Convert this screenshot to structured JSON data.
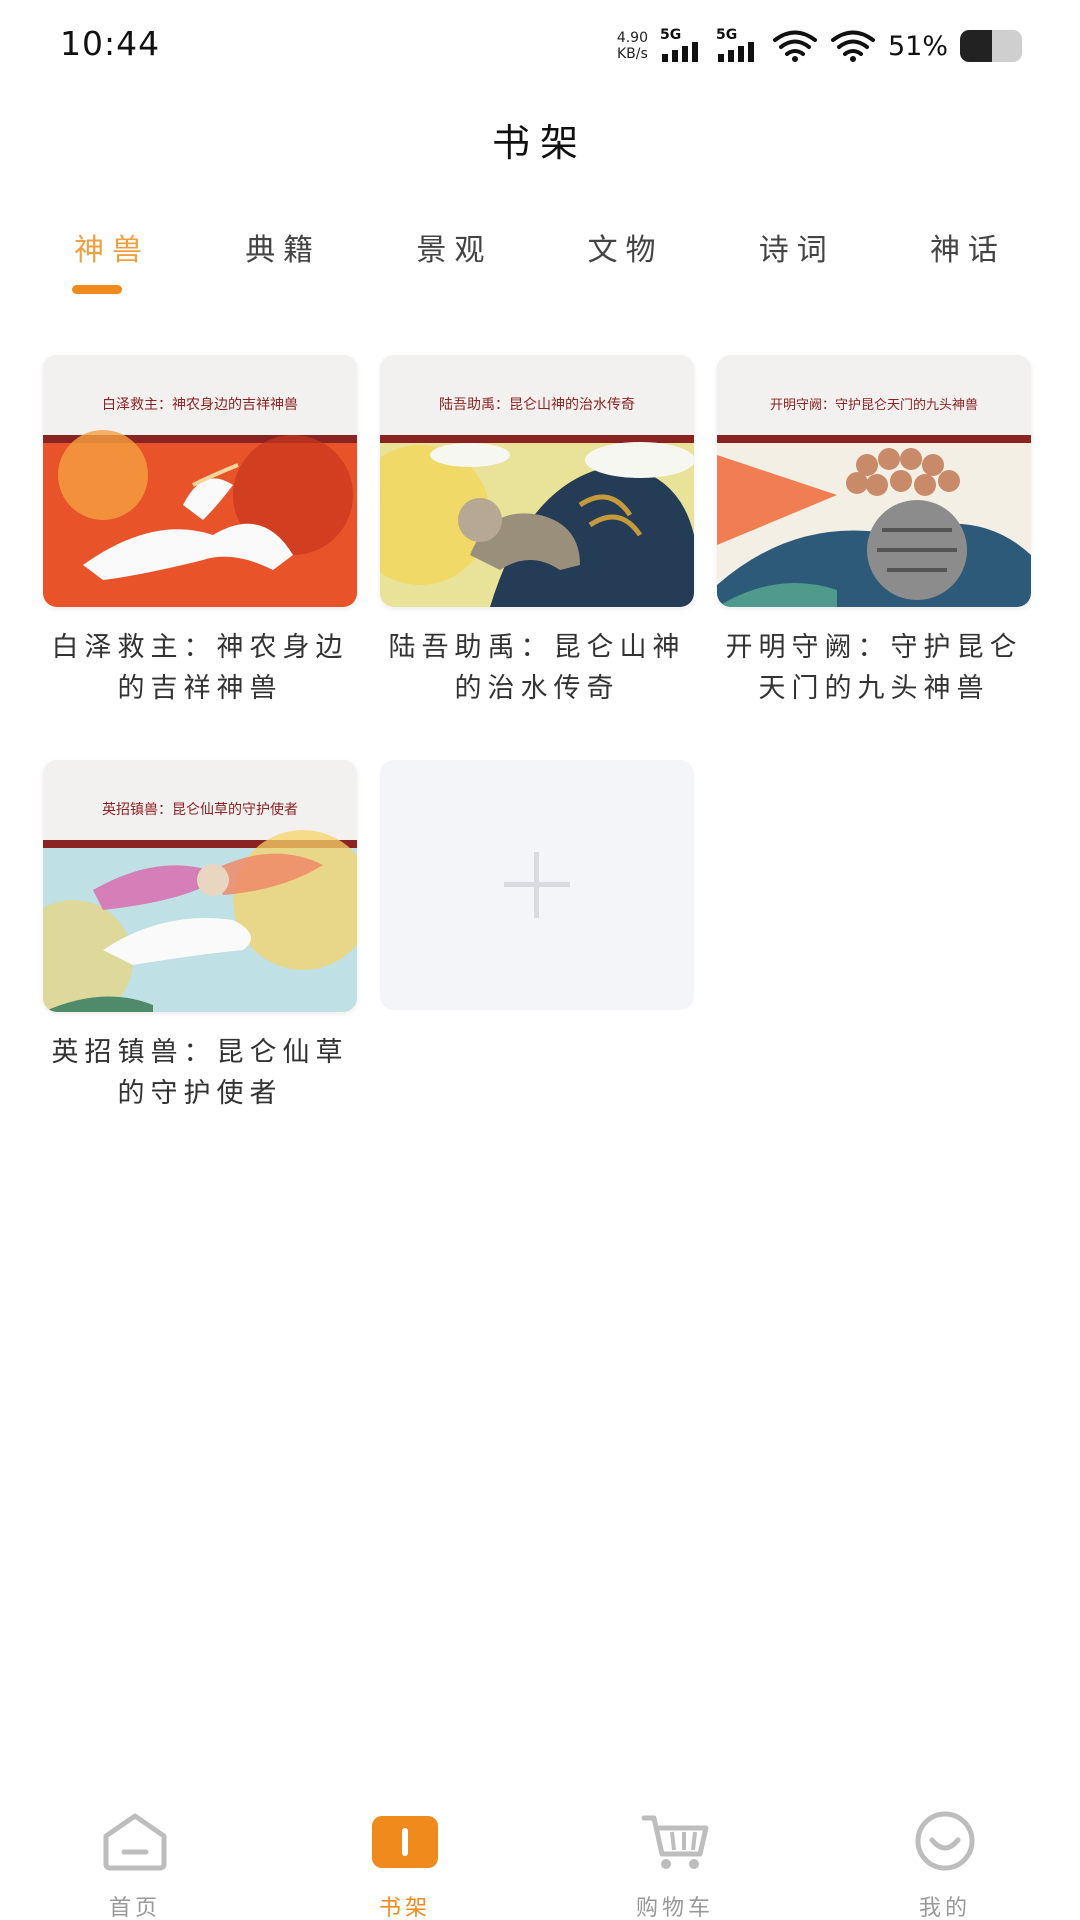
{
  "status_bar": {
    "time": "10:44",
    "net_speed_value": "4.90",
    "net_speed_unit": "KB/s",
    "signal_1": "5G",
    "signal_2": "5G",
    "battery_percent": "51%",
    "battery_level": 0.51
  },
  "page": {
    "title": "书架"
  },
  "tabs": [
    {
      "label": "神兽",
      "active": true
    },
    {
      "label": "典籍",
      "active": false
    },
    {
      "label": "景观",
      "active": false
    },
    {
      "label": "文物",
      "active": false
    },
    {
      "label": "诗词",
      "active": false
    },
    {
      "label": "神话",
      "active": false
    }
  ],
  "books": [
    {
      "title": "白泽救主：神农身边的吉祥神兽",
      "cover_heading": "白泽救主：神农身边的吉祥神兽"
    },
    {
      "title": "陆吾助禹：昆仑山神的治水传奇",
      "cover_heading": "陆吾助禹：昆仑山神的治水传奇"
    },
    {
      "title": "开明守阙：守护昆仑天门的九头神兽",
      "cover_heading": "开明守阙：守护昆仑天门的九头神兽"
    },
    {
      "title": "英招镇兽：昆仑仙草的守护使者",
      "cover_heading": "英招镇兽：昆仑仙草的守护使者"
    }
  ],
  "bottom_nav": [
    {
      "label": "首页",
      "icon": "home-icon",
      "active": false
    },
    {
      "label": "书架",
      "icon": "bookshelf-icon",
      "active": true
    },
    {
      "label": "购物车",
      "icon": "cart-icon",
      "active": false
    },
    {
      "label": "我的",
      "icon": "profile-icon",
      "active": false
    }
  ],
  "colors": {
    "accent": "#f08a1c",
    "tab_active_text": "#f0a040",
    "cover_band": "#8b2323"
  }
}
